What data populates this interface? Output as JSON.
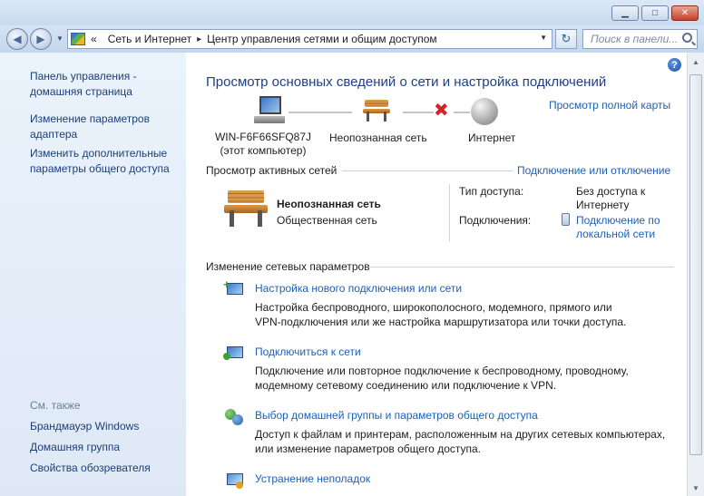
{
  "window": {
    "minimize_glyph": "▁",
    "maximize_glyph": "□",
    "close_glyph": "✕"
  },
  "nav": {
    "back_glyph": "◀",
    "forward_glyph": "▶",
    "dropdown_glyph": "▼"
  },
  "address": {
    "chevrons": "«",
    "crumbs": [
      "Сеть и Интернет",
      "Центр управления сетями и общим доступом"
    ],
    "separator": "▸",
    "dropdown_glyph": "▼",
    "refresh_glyph": "↻"
  },
  "search": {
    "placeholder": "Поиск в панели..."
  },
  "sidebar": {
    "items": [
      "Панель управления -\nдомашняя страница",
      "Изменение параметров\nадаптера",
      "Изменить дополнительные\nпараметры общего доступа"
    ],
    "see_also_label": "См. также",
    "see_also": [
      "Брандмауэр Windows",
      "Домашняя группа",
      "Свойства обозревателя"
    ]
  },
  "main": {
    "help_glyph": "?",
    "title": "Просмотр основных сведений о сети и настройка подключений",
    "full_map_link": "Просмотр полной карты",
    "map": {
      "computer": "WIN-F6F66SFQ87J",
      "computer_sub": "(этот компьютер)",
      "network": "Неопознанная сеть",
      "internet": "Интернет",
      "x_glyph": "✖"
    },
    "active": {
      "heading": "Просмотр активных сетей",
      "connect_link": "Подключение или отключение",
      "network_name": "Неопознанная сеть",
      "network_type": "Общественная сеть",
      "access_label": "Тип доступа:",
      "access_value": "Без доступа к\nИнтернету",
      "connections_label": "Подключения:",
      "connections_value": "Подключение по\nлокальной сети"
    },
    "change": {
      "heading": "Изменение сетевых параметров",
      "tasks": [
        {
          "title": "Настройка нового подключения или сети",
          "desc": "Настройка беспроводного, широкополосного, модемного, прямого или\nVPN-подключения или же настройка маршрутизатора или точки доступа."
        },
        {
          "title": "Подключиться к сети",
          "desc": "Подключение или повторное подключение к беспроводному, проводному,\nмодемному сетевому соединению или подключение к VPN."
        },
        {
          "title": "Выбор домашней группы и параметров общего доступа",
          "desc": "Доступ к файлам и принтерам, расположенным на других сетевых компьютерах,\nили изменение параметров общего доступа."
        },
        {
          "title": "Устранение неполадок",
          "desc": ""
        }
      ]
    }
  },
  "scrollbar": {
    "up_glyph": "▲",
    "down_glyph": "▼"
  }
}
